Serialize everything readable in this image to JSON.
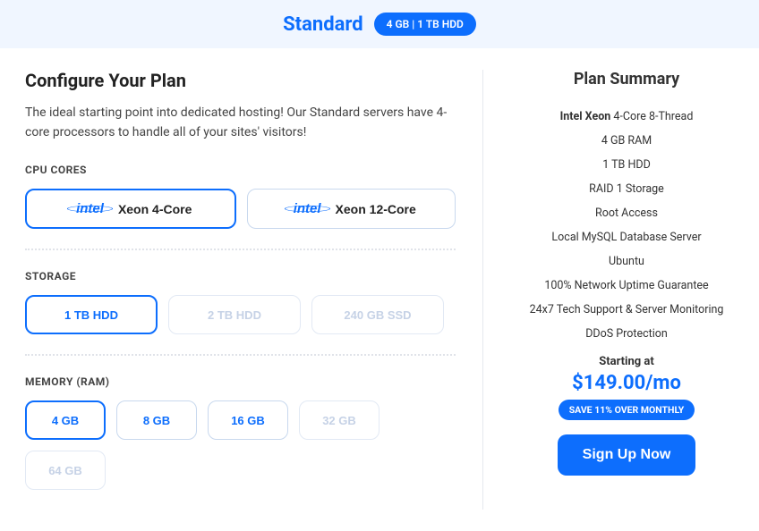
{
  "header": {
    "plan_name": "Standard",
    "badge": "4 GB | 1 TB HDD"
  },
  "main": {
    "title": "Configure Your Plan",
    "description": "The ideal starting point into dedicated hosting! Our Standard servers have 4-core processors to handle all of your sites' visitors!",
    "cpu": {
      "label": "CPU CORES",
      "options": [
        {
          "brand": "intel",
          "text": "Xeon 4-Core",
          "selected": true,
          "disabled": false
        },
        {
          "brand": "intel",
          "text": "Xeon 12-Core",
          "selected": false,
          "disabled": false
        }
      ]
    },
    "storage": {
      "label": "STORAGE",
      "options": [
        {
          "text": "1 TB HDD",
          "selected": true,
          "disabled": false
        },
        {
          "text": "2 TB HDD",
          "selected": false,
          "disabled": true
        },
        {
          "text": "240 GB SSD",
          "selected": false,
          "disabled": true
        }
      ]
    },
    "memory": {
      "label": "MEMORY (RAM)",
      "options": [
        {
          "text": "4 GB",
          "selected": true,
          "disabled": false
        },
        {
          "text": "8 GB",
          "selected": false,
          "disabled": false
        },
        {
          "text": "16 GB",
          "selected": false,
          "disabled": false
        },
        {
          "text": "32 GB",
          "selected": false,
          "disabled": true
        },
        {
          "text": "64 GB",
          "selected": false,
          "disabled": true
        }
      ]
    }
  },
  "summary": {
    "title": "Plan Summary",
    "items": [
      {
        "bold": "Intel Xeon",
        "rest": " 4-Core 8-Thread"
      },
      {
        "bold": "",
        "rest": "4 GB RAM"
      },
      {
        "bold": "",
        "rest": "1 TB HDD"
      },
      {
        "bold": "",
        "rest": "RAID 1 Storage"
      },
      {
        "bold": "",
        "rest": "Root Access"
      },
      {
        "bold": "",
        "rest": "Local MySQL Database Server"
      },
      {
        "bold": "",
        "rest": "Ubuntu"
      },
      {
        "bold": "",
        "rest": "100% Network Uptime Guarantee"
      },
      {
        "bold": "",
        "rest": "24x7 Tech Support & Server Monitoring"
      },
      {
        "bold": "",
        "rest": "DDoS Protection"
      }
    ],
    "starting_label": "Starting at",
    "price": "$149.00/mo",
    "save_badge": "SAVE 11% OVER MONTHLY",
    "signup_label": "Sign Up Now"
  }
}
